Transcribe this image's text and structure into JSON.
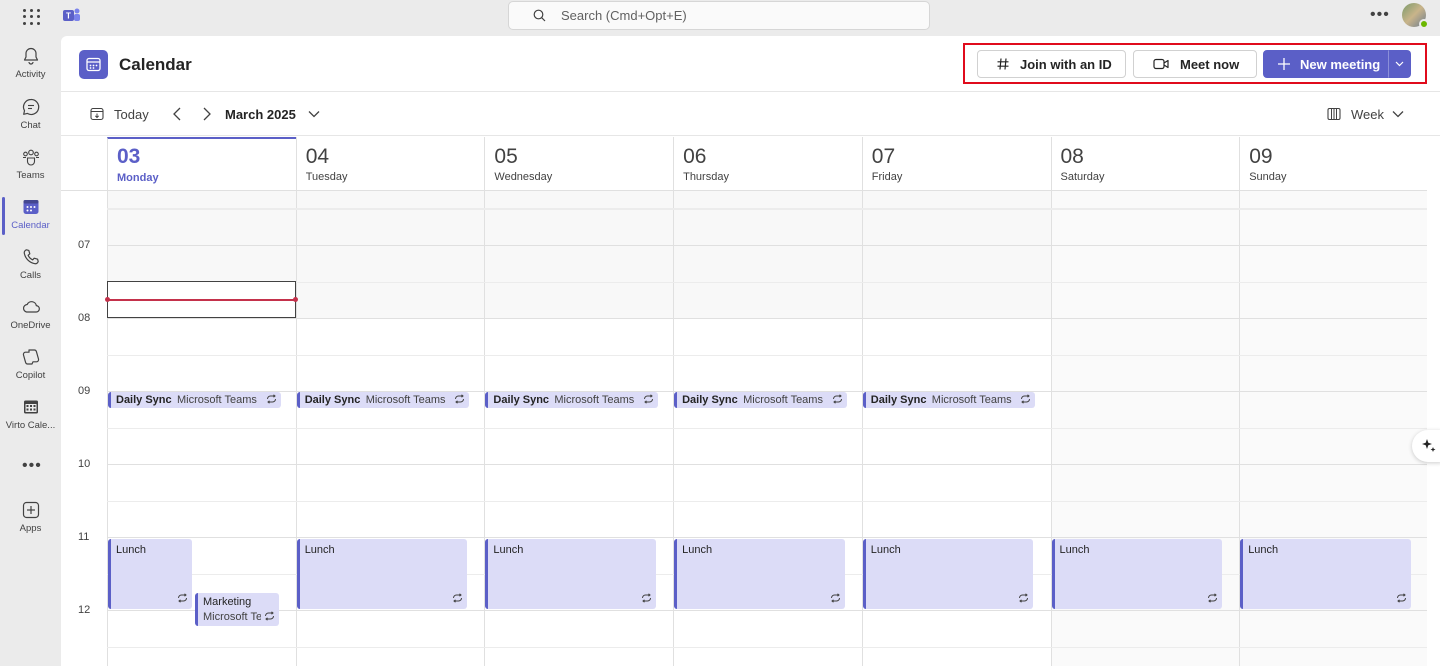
{
  "search": {
    "placeholder": "Search (Cmd+Opt+E)"
  },
  "rail": {
    "items": [
      {
        "label": "Activity",
        "icon": "bell-icon"
      },
      {
        "label": "Chat",
        "icon": "chat-icon"
      },
      {
        "label": "Teams",
        "icon": "teams-icon"
      },
      {
        "label": "Calendar",
        "icon": "calendar-icon",
        "active": true
      },
      {
        "label": "Calls",
        "icon": "phone-icon"
      },
      {
        "label": "OneDrive",
        "icon": "cloud-icon"
      },
      {
        "label": "Copilot",
        "icon": "copilot-icon"
      },
      {
        "label": "Virto Cale...",
        "icon": "virto-calendar-icon"
      },
      {
        "label": "Apps",
        "icon": "add-apps-icon"
      }
    ],
    "more": "•••"
  },
  "topbar": {
    "more": "•••"
  },
  "header": {
    "title": "Calendar",
    "join_label": "Join with an ID",
    "meet_label": "Meet now",
    "new_label": "New meeting"
  },
  "toolbar": {
    "today_label": "Today",
    "month_label": "March 2025",
    "view_label": "Week"
  },
  "days": [
    {
      "num": "03",
      "name": "Monday",
      "current": true
    },
    {
      "num": "04",
      "name": "Tuesday"
    },
    {
      "num": "05",
      "name": "Wednesday"
    },
    {
      "num": "06",
      "name": "Thursday"
    },
    {
      "num": "07",
      "name": "Friday"
    },
    {
      "num": "08",
      "name": "Saturday",
      "weekend": true
    },
    {
      "num": "09",
      "name": "Sunday",
      "weekend": true
    }
  ],
  "hours": [
    "07",
    "08",
    "09",
    "10",
    "11",
    "12"
  ],
  "events": {
    "daily_sync": {
      "title": "Daily Sync",
      "subtitle": "Microsoft Teams Meeting",
      "days": [
        0,
        1,
        2,
        3,
        4
      ]
    },
    "lunch": {
      "title": "Lunch",
      "days": [
        0,
        1,
        2,
        3,
        4,
        5,
        6
      ]
    },
    "marketing": {
      "title": "Marketing",
      "subtitle": "Microsoft Teams Meeting",
      "day": 0
    }
  },
  "colors": {
    "brand": "#5b5fc7",
    "event_bg": "#dcdcf7",
    "now_line": "#c4314b",
    "highlight": "#e00b1c"
  }
}
